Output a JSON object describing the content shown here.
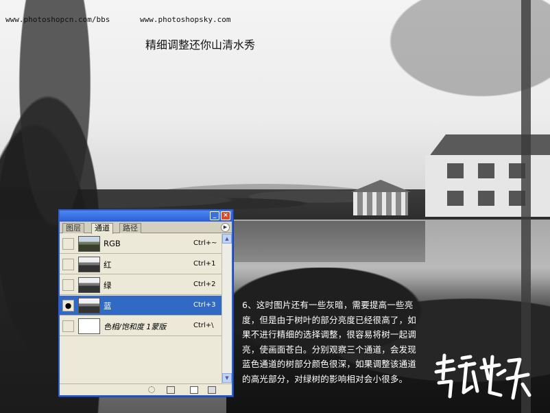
{
  "watermark": {
    "url_left": "www.photoshopcn.com/bbs",
    "url_right": "www.photoshopsky.com"
  },
  "headline": "精细调整还你山清水秀",
  "palette": {
    "tabs": [
      "图层",
      "通道",
      "路径"
    ],
    "active_tab": "通道",
    "rows": [
      {
        "label": "RGB",
        "shortcut": "Ctrl+~",
        "visible": false,
        "selected": false
      },
      {
        "label": "红",
        "shortcut": "Ctrl+1",
        "visible": false,
        "selected": false
      },
      {
        "label": "绿",
        "shortcut": "Ctrl+2",
        "visible": false,
        "selected": false
      },
      {
        "label": "蓝",
        "shortcut": "Ctrl+3",
        "visible": true,
        "selected": true
      },
      {
        "label": "色相/饱和度 1蒙版",
        "shortcut": "Ctrl+\\",
        "visible": false,
        "selected": false
      }
    ],
    "selection_color": "#316ac5",
    "titlebar_color": "#2a5ed8"
  },
  "description": "6、这时图片还有一些灰暗，需要提高一些亮度，但是由于树叶的部分亮度已经很高了，如果不进行精细的选择调整，很容易将树一起调亮，使画面苍白。分别观察三个通道，会发现蓝色通道的树部分颜色很深，如果调整该通道的高光部分，对绿树的影响相对会小很多。",
  "signature_text": "精品教程"
}
